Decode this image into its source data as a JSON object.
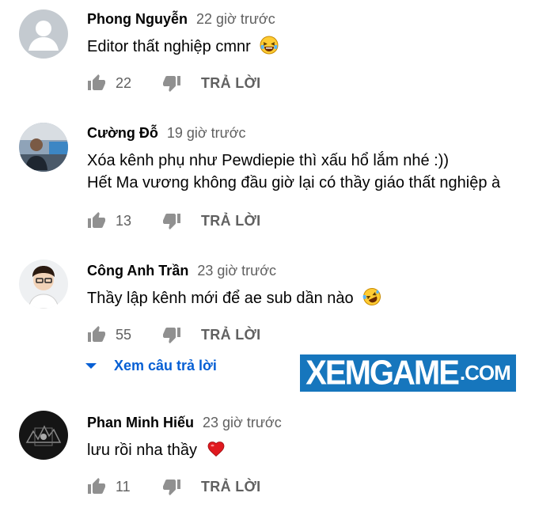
{
  "reply_label": "TRẢ LỜI",
  "comments": [
    {
      "author": "Phong Nguyễn",
      "time": "22 giờ trước",
      "lines": [
        "Editor thất nghiệp cmnr"
      ],
      "emoji": "laughing-tears-emoji",
      "likes": "22"
    },
    {
      "author": "Cường Đỗ",
      "time": "19 giờ trước",
      "lines": [
        "Xóa kênh phụ như Pewdiepie thì xấu hổ lắm nhé :))",
        "Hết Ma vương không đầu giờ lại có thầy giáo thất nghiệp à"
      ],
      "likes": "13"
    },
    {
      "author": "Công Anh Trần",
      "time": "23 giờ trước",
      "lines": [
        "Thầy lập kênh mới để ae sub dần nào"
      ],
      "emoji": "crying-laughing-emoji",
      "likes": "55"
    },
    {
      "author": "Phan Minh Hiếu",
      "time": "23 giờ trước",
      "lines": [
        "lưu rồi nha thầy"
      ],
      "emoji": "red-heart-emoji",
      "likes": "11"
    }
  ],
  "view_replies": "Xem câu trả lời",
  "watermark": {
    "main": "XEMGAME",
    "suffix": ".COM",
    "color": "#1676bd"
  },
  "colors": {
    "link": "#065fd4",
    "muted": "#606060",
    "icon": "#909090"
  }
}
